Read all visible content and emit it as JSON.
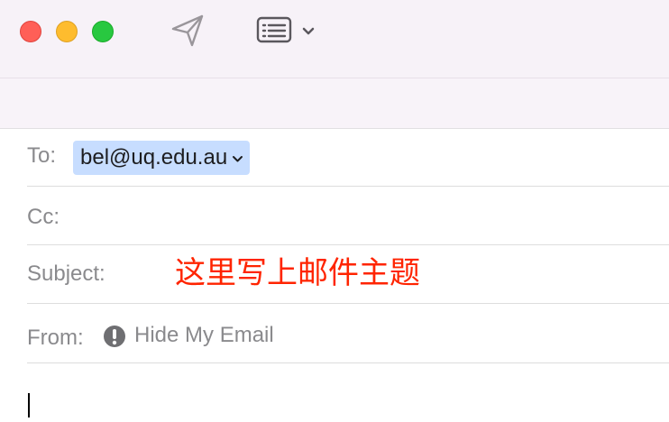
{
  "window": {
    "controls": [
      "close",
      "minimize",
      "zoom"
    ]
  },
  "toolbar": {
    "send_icon": "paper-plane-icon",
    "format_icon": "message-list-icon",
    "dropdown_icon": "chevron-down-icon"
  },
  "compose": {
    "to_label": "To:",
    "to_recipient": "bel@uq.edu.au",
    "cc_label": "Cc:",
    "subject_label": "Subject:",
    "subject_value": "这里写上邮件主题",
    "from_label": "From:",
    "from_icon": "exclamation-circle-icon",
    "from_value": "Hide My Email"
  },
  "colors": {
    "toolbar_background": "#f7f2f8",
    "recipient_token": "#c7ddff",
    "subject_text": "#ff2400",
    "close": "#ff5f57",
    "minimize": "#febc2e",
    "zoom": "#28c840"
  }
}
